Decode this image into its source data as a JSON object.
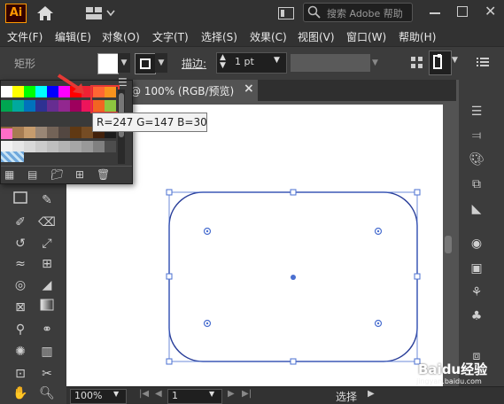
{
  "app": {
    "logo": "Ai"
  },
  "search": {
    "placeholder": "搜索 Adobe 帮助"
  },
  "menu": [
    "文件(F)",
    "编辑(E)",
    "对象(O)",
    "文字(T)",
    "选择(S)",
    "效果(C)",
    "视图(V)",
    "窗口(W)",
    "帮助(H)"
  ],
  "control": {
    "shape_label": "矩形",
    "stroke_label": "描边:",
    "stroke_value": "1 pt"
  },
  "document": {
    "tab_title": "@ 100% (RGB/预览)",
    "tab_close": "×"
  },
  "tooltip": {
    "text": "R=247 G=147 B=30"
  },
  "status": {
    "zoom": "100%",
    "page": "1",
    "mode": "选择"
  },
  "watermark": {
    "text": "Baidu经验",
    "url": "jingyan.baidu.com"
  },
  "colors": {
    "accent_highlight": "#e53935",
    "selection_blue": "#4a6fd0",
    "selected_swatch": "#f7931e",
    "swatch_row1": [
      "#ffffff",
      "#ffff00",
      "#00ff00",
      "#00ffff",
      "#0000ff",
      "#ff00ff",
      "#ff0000",
      "#ee2233",
      "#ff6633",
      "#f7931e"
    ],
    "swatch_row2": [
      "#00a651",
      "#00a99d",
      "#0072bc",
      "#2e3192",
      "#662d91",
      "#92278f",
      "#9e005d",
      "#ed145b",
      "#f26522",
      "#8dc63f"
    ],
    "swatch_row3": [
      "#8c6239",
      "#a67c52",
      "#c69c6d",
      "#998675",
      "#736357",
      "#534741",
      "#603913",
      "#754c24",
      "#42210b",
      "#1c1c1c"
    ],
    "swatch_row4": [
      "#f2f2f2",
      "#e6e6e6",
      "#d9d9d9",
      "#cccccc",
      "#bfbfbf",
      "#b3b3b3",
      "#a6a6a6",
      "#999999",
      "#808080",
      "#4d4d4d"
    ]
  }
}
